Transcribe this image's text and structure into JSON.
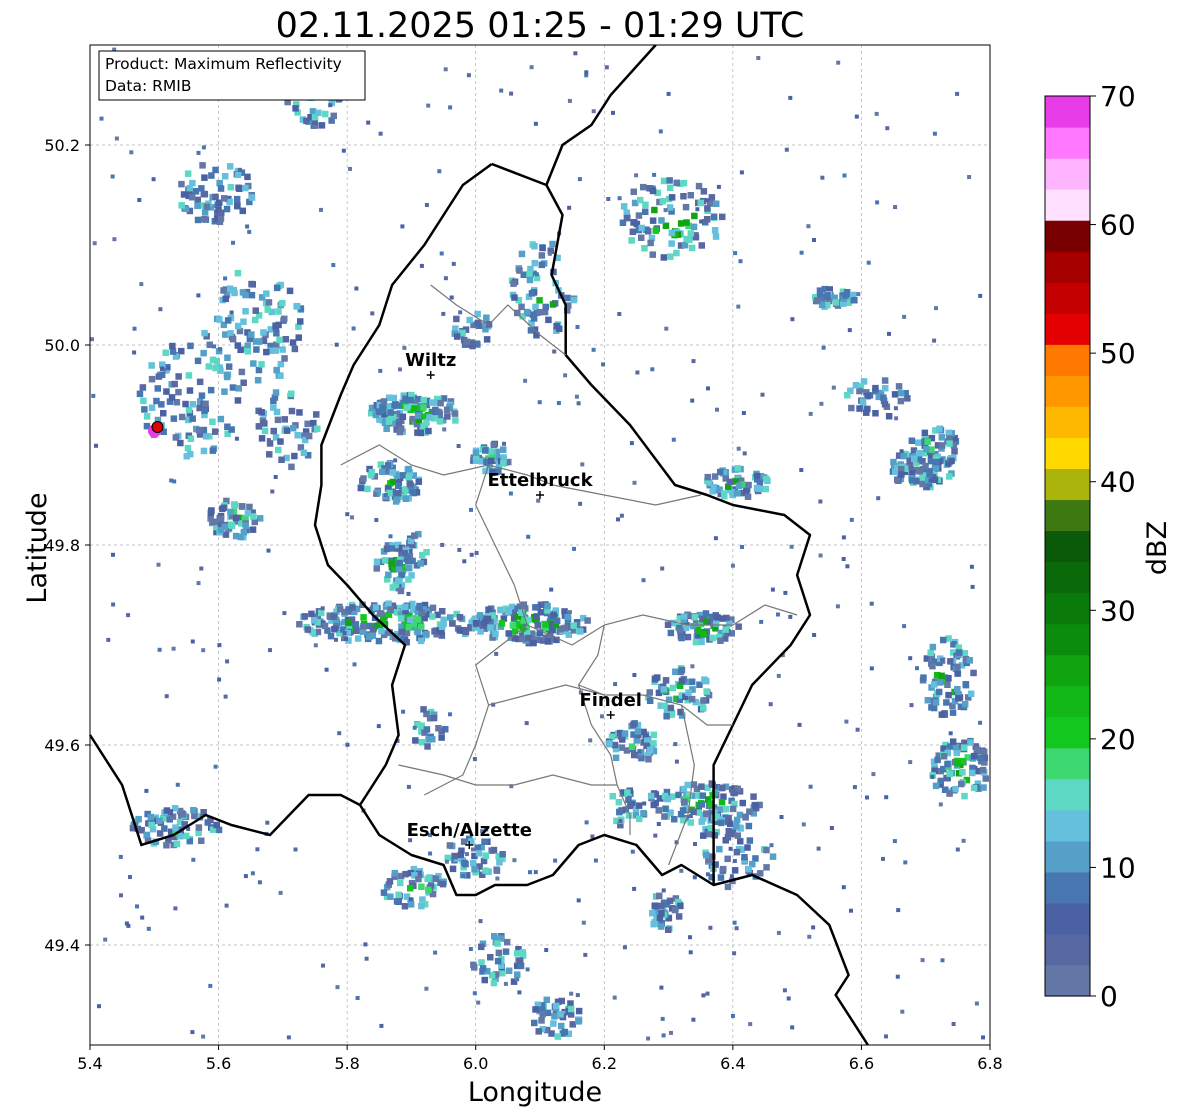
{
  "title": "02.11.2025 01:25 - 01:29 UTC",
  "info_box": {
    "product": "Product: Maximum Reflectivity",
    "data": "Data: RMIB"
  },
  "axes": {
    "xlabel": "Longitude",
    "ylabel": "Latitude",
    "x_range": [
      5.4,
      6.8
    ],
    "y_range": [
      49.3,
      50.3
    ],
    "x_ticks": [
      "5.4",
      "5.6",
      "5.8",
      "6.0",
      "6.2",
      "6.4",
      "6.6",
      "6.8"
    ],
    "y_ticks": [
      "49.4",
      "49.6",
      "49.8",
      "50.0",
      "50.2"
    ],
    "grid": true
  },
  "colorbar": {
    "label": "dBZ",
    "range": [
      0,
      70
    ],
    "ticks": [
      "0",
      "10",
      "20",
      "30",
      "40",
      "50",
      "60",
      "70"
    ],
    "colors": [
      "#6478a8",
      "#5868a2",
      "#4a62a4",
      "#4876b0",
      "#54a0c8",
      "#64c0dc",
      "#5cd8c4",
      "#3ed870",
      "#12c81e",
      "#12b818",
      "#10a410",
      "#0c8c0c",
      "#0a7a0a",
      "#0a6a0a",
      "#0a5a0a",
      "#3e7810",
      "#aab40a",
      "#ffd800",
      "#ffb800",
      "#ff9800",
      "#ff7800",
      "#e40000",
      "#c40000",
      "#a40000",
      "#780000",
      "#ffe0ff",
      "#ffb4ff",
      "#ff78ff",
      "#e83ce8"
    ]
  },
  "cities": [
    {
      "name": "Wiltz",
      "lon": 5.93,
      "lat": 49.97
    },
    {
      "name": "Ettelbruck",
      "lon": 6.1,
      "lat": 49.85
    },
    {
      "name": "Findel",
      "lon": 6.21,
      "lat": 49.63
    },
    {
      "name": "Esch/Alzette",
      "lon": 5.99,
      "lat": 49.5
    }
  ],
  "marker": {
    "lon": 5.505,
    "lat": 49.918,
    "color": "#e00000"
  }
}
